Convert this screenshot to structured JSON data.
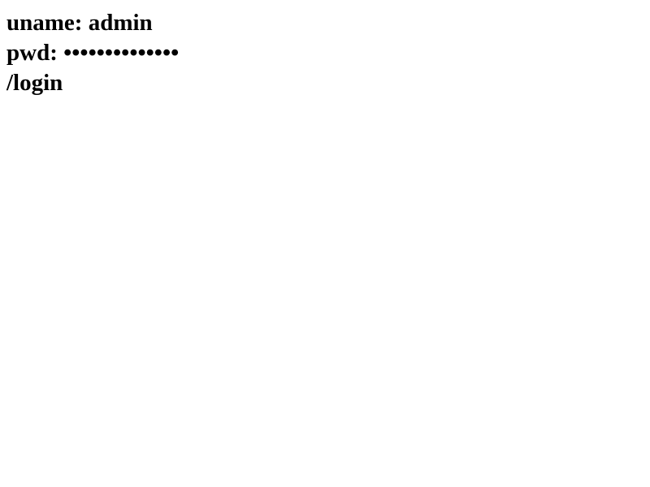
{
  "lines": {
    "username": "uname: admin",
    "password": "pwd: ••••••••••••••",
    "path": "/login"
  }
}
